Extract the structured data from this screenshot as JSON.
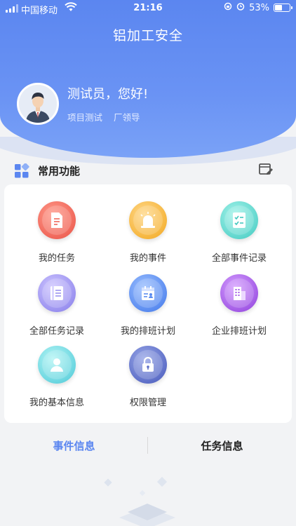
{
  "status_bar": {
    "carrier": "中国移动",
    "time": "21:16",
    "battery": "53%",
    "battery_level": 0.53
  },
  "app": {
    "title": "铝加工安全"
  },
  "profile": {
    "greeting": "测试员，您好!",
    "project": "项目测试",
    "role": "厂领导"
  },
  "section": {
    "title": "常用功能"
  },
  "functions": [
    {
      "label": "我的任务",
      "icon": "document-icon",
      "color": "#f0675a"
    },
    {
      "label": "我的事件",
      "icon": "alarm-light-icon",
      "color": "#f6b63e"
    },
    {
      "label": "全部事件记录",
      "icon": "checklist-icon",
      "color": "#5fd6cd"
    },
    {
      "label": "全部任务记录",
      "icon": "list-icon",
      "color": "#9b92f0"
    },
    {
      "label": "我的排班计划",
      "icon": "calendar-user-icon",
      "color": "#5b8cf0"
    },
    {
      "label": "企业排班计划",
      "icon": "building-icon",
      "color": "#a35be6"
    },
    {
      "label": "我的基本信息",
      "icon": "user-icon",
      "color": "#6bd6e0"
    },
    {
      "label": "权限管理",
      "icon": "lock-icon",
      "color": "#5e6fc8"
    }
  ],
  "tabs": [
    {
      "label": "事件信息",
      "active": true
    },
    {
      "label": "任务信息",
      "active": false
    }
  ],
  "colors": {
    "accent": "#5b86f0",
    "background": "#f2f3f5"
  }
}
